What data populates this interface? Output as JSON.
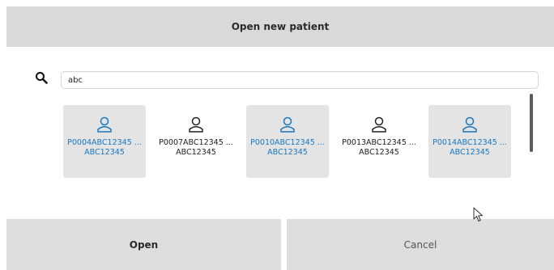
{
  "dialog": {
    "title": "Open new patient"
  },
  "search": {
    "value": "abc",
    "icon": "search-icon"
  },
  "patients": [
    {
      "code": "P0004ABC12345 ...",
      "sub": "ABC12345",
      "selected": true
    },
    {
      "code": "P0007ABC12345 ...",
      "sub": "ABC12345",
      "selected": false
    },
    {
      "code": "P0010ABC12345 ...",
      "sub": "ABC12345",
      "selected": true
    },
    {
      "code": "P0013ABC12345 ...",
      "sub": "ABC12345",
      "selected": false
    },
    {
      "code": "P0014ABC12345 ...",
      "sub": "ABC12345",
      "selected": true
    }
  ],
  "buttons": {
    "open_label": "Open",
    "cancel_label": "Cancel"
  },
  "colors": {
    "accent": "#1976c0",
    "bar": "#d9d9d9",
    "tile_selected": "#e4e4e4"
  }
}
